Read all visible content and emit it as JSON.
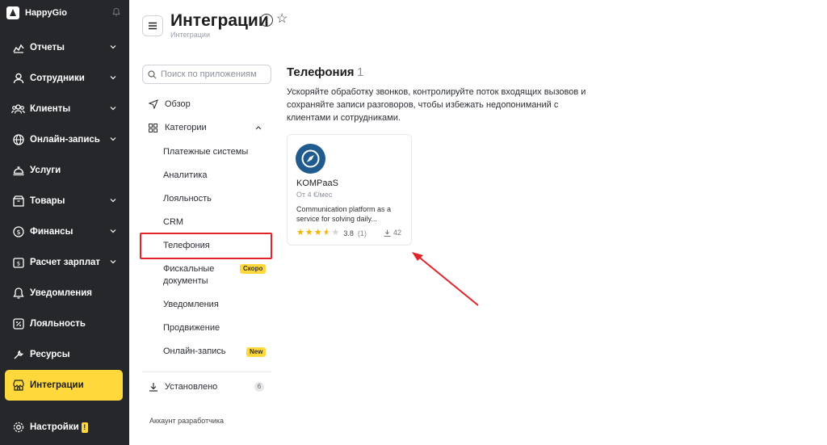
{
  "app": {
    "brand": "HappyGio"
  },
  "sidebar": {
    "items": [
      {
        "label": "Отчеты",
        "icon": "chart-icon",
        "expandable": true
      },
      {
        "label": "Сотрудники",
        "icon": "user-icon",
        "expandable": true
      },
      {
        "label": "Клиенты",
        "icon": "users-icon",
        "expandable": true
      },
      {
        "label": "Онлайн-запись",
        "icon": "globe-icon",
        "expandable": true
      },
      {
        "label": "Услуги",
        "icon": "service-bell-icon",
        "expandable": false
      },
      {
        "label": "Товары",
        "icon": "box-icon",
        "expandable": true
      },
      {
        "label": "Финансы",
        "icon": "coin-icon",
        "expandable": true
      },
      {
        "label": "Расчет зарплат",
        "icon": "wallet-icon",
        "expandable": true
      },
      {
        "label": "Уведомления",
        "icon": "bell-icon",
        "expandable": false
      },
      {
        "label": "Лояльность",
        "icon": "percent-icon",
        "expandable": false
      },
      {
        "label": "Ресурсы",
        "icon": "wrench-icon",
        "expandable": false
      },
      {
        "label": "Интеграции",
        "icon": "store-icon",
        "expandable": false,
        "active": true
      }
    ],
    "settings": {
      "label": "Настройки",
      "badge": "!"
    }
  },
  "header": {
    "title": "Интеграции",
    "breadcrumb": "Интеграции"
  },
  "subnav": {
    "search_placeholder": "Поиск по приложениям",
    "overview": "Обзор",
    "categories": "Категории",
    "category_items": [
      "Платежные системы",
      "Аналитика",
      "Лояльность",
      "CRM",
      "Телефония",
      "Фискальные",
      "Уведомления",
      "Продвижение",
      "Онлайн-запись"
    ],
    "fiscal_line2": "документы",
    "badge_soon": "Скоро",
    "badge_new": "New",
    "installed": "Установлено",
    "installed_count": "6",
    "developer_account": "Аккаунт разработчика"
  },
  "main": {
    "section_title": "Телефония",
    "section_count": "1",
    "section_description": "Ускоряйте обработку звонков, контролируйте поток входящих вызовов и сохраняйте записи разговоров, чтобы избежать недопониманий с клиентами и сотрудниками.",
    "card": {
      "name": "KOMPaaS",
      "price": "От 4 €/мес",
      "description": "Communication platform as a service for solving daily...",
      "rating": "3.8",
      "rating_value": 3.8,
      "rating_count": "(1)",
      "downloads": "42"
    }
  },
  "colors": {
    "sidebar_bg": "#25272b",
    "accent": "#ffd83b",
    "highlight_red": "#e0242b",
    "card_logo": "#1f5b8f"
  }
}
